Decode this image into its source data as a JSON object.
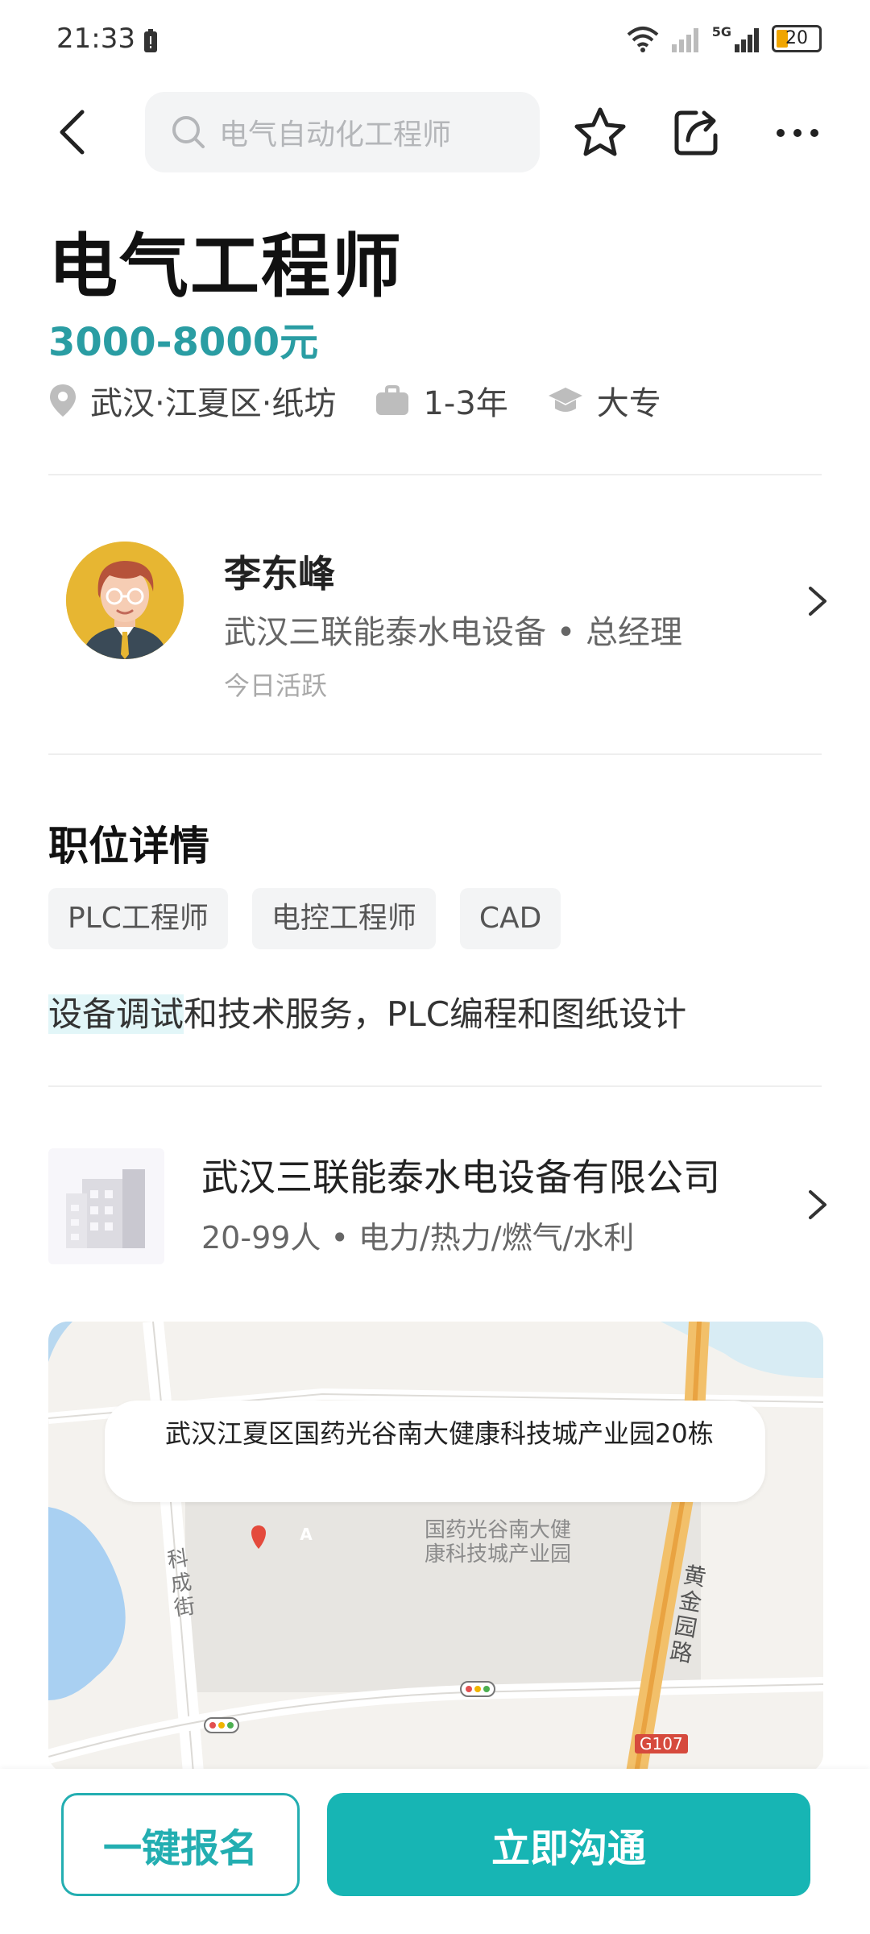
{
  "status_bar": {
    "time": "21:33",
    "network": "5G",
    "battery": "20"
  },
  "nav": {
    "search_placeholder": "电气自动化工程师"
  },
  "job": {
    "title": "电气工程师",
    "salary": "3000-8000元",
    "location": "武汉·江夏区·纸坊",
    "experience": "1-3年",
    "education": "大专"
  },
  "recruiter": {
    "name": "李东峰",
    "company_role": "武汉三联能泰水电设备 • 总经理",
    "activity": "今日活跃"
  },
  "details": {
    "section_title": "职位详情",
    "tags": [
      "PLC工程师",
      "电控工程师",
      "CAD"
    ],
    "description_highlight": "设备调试",
    "description_rest": "和技术服务，PLC编程和图纸设计"
  },
  "company": {
    "name": "武汉三联能泰水电设备有限公司",
    "info": "20-99人 • 电力/热力/燃气/水利"
  },
  "map": {
    "address": "武汉江夏区国药光谷南大健康科技城产业园20栋",
    "poi_line1": "国药光谷南大健",
    "poi_line2": "康科技城产业园",
    "street_left": "科成街",
    "street_right": "黄金园路",
    "highway": "G107",
    "marker": "A"
  },
  "actions": {
    "quick_apply": "一键报名",
    "chat_now": "立即沟通"
  },
  "colors": {
    "accent": "#17b5b4",
    "salary": "#2a9da3"
  }
}
